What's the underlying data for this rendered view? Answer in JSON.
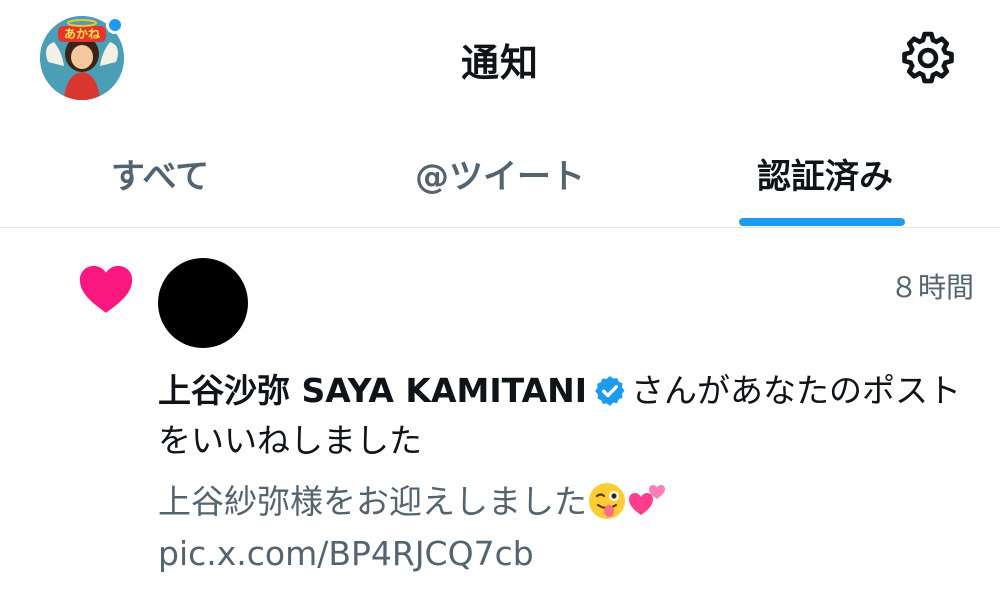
{
  "header": {
    "title": "通知",
    "avatar_badge": "あかね"
  },
  "tabs": [
    {
      "label": "すべて",
      "active": false
    },
    {
      "label": "@ツイート",
      "active": false
    },
    {
      "label": "認証済み",
      "active": true
    }
  ],
  "notification": {
    "icon": "heart-icon",
    "time": "８時間",
    "user_name": "上谷沙弥 SAYA KAMITANI",
    "action_text": "さんがあなたのポストをいいねしました",
    "post_text": "上谷紗弥様をお迎えしました",
    "post_link": "pic.x.com/BP4RJCQ7cb"
  },
  "colors": {
    "accent": "#1d9bf0",
    "heart": "#f91880",
    "secondary_text": "#536471"
  }
}
